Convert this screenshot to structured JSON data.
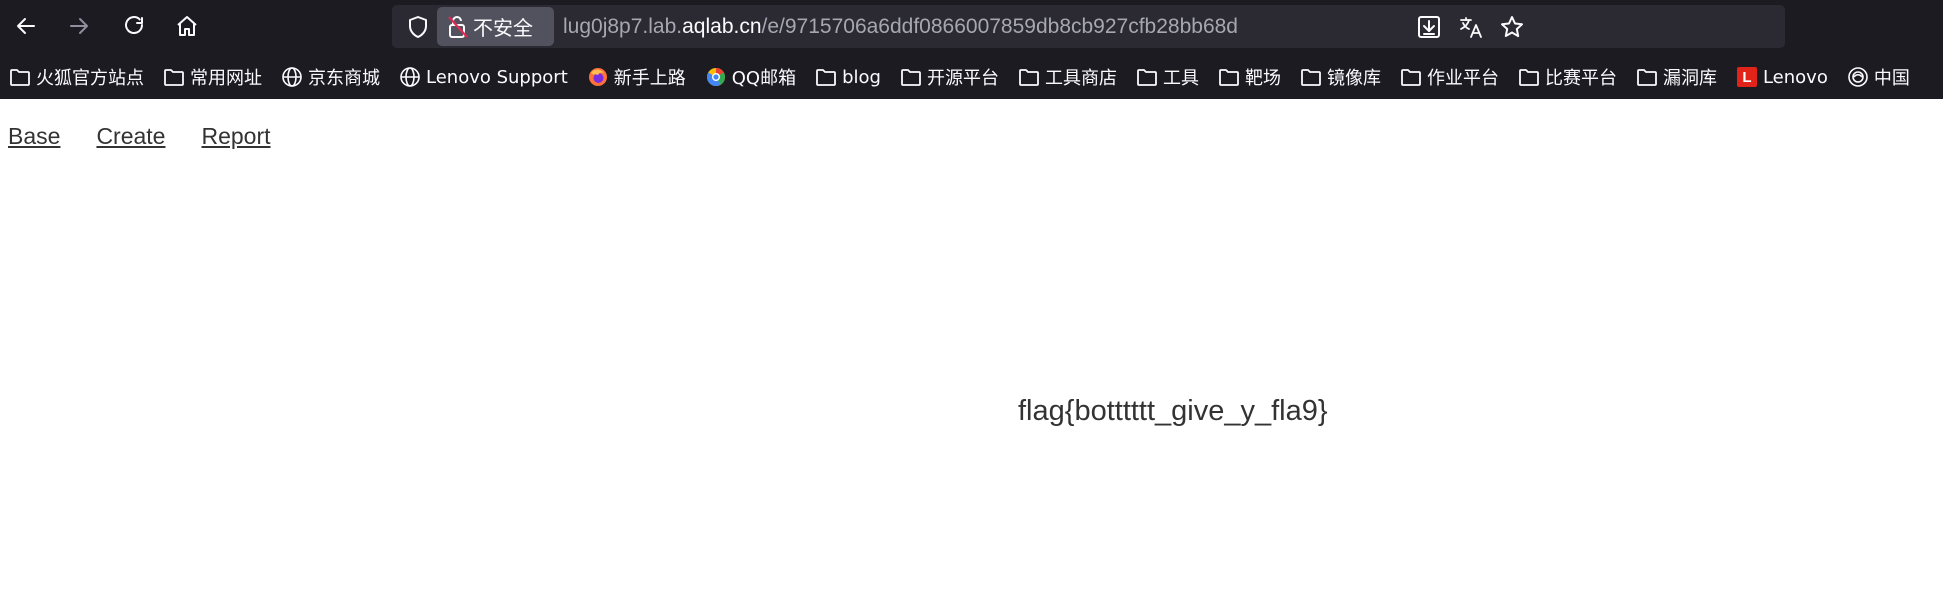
{
  "browser": {
    "security_label": "不安全",
    "url_prefix": "lug0j8p7.lab.",
    "url_host": "aqlab.cn",
    "url_path": "/e/9715706a6ddf0866007859db8cb927cfb28bb68d",
    "nav_icons": [
      "back-arrow-icon",
      "forward-arrow-icon",
      "reload-icon",
      "home-icon"
    ],
    "urlbar_icons": [
      "shield-icon",
      "insecure-lock-icon",
      "download-icon",
      "translate-icon",
      "star-icon"
    ],
    "bookmarks": [
      {
        "label": "火狐官方站点",
        "icon": "folder-icon"
      },
      {
        "label": "常用网址",
        "icon": "folder-icon"
      },
      {
        "label": "京东商城",
        "icon": "globe-icon"
      },
      {
        "label": "Lenovo Support",
        "icon": "globe-icon"
      },
      {
        "label": "新手上路",
        "icon": "firefox-icon"
      },
      {
        "label": "QQ邮箱",
        "icon": "qqmail-icon"
      },
      {
        "label": "blog",
        "icon": "folder-icon"
      },
      {
        "label": "开源平台",
        "icon": "folder-icon"
      },
      {
        "label": "工具商店",
        "icon": "folder-icon"
      },
      {
        "label": "工具",
        "icon": "folder-icon"
      },
      {
        "label": "靶场",
        "icon": "folder-icon"
      },
      {
        "label": "镜像库",
        "icon": "folder-icon"
      },
      {
        "label": "作业平台",
        "icon": "folder-icon"
      },
      {
        "label": "比赛平台",
        "icon": "folder-icon"
      },
      {
        "label": "漏洞库",
        "icon": "folder-icon"
      },
      {
        "label": "Lenovo",
        "icon": "lenovo-icon"
      },
      {
        "label": "中国",
        "icon": "site-icon"
      }
    ],
    "colors": {
      "chrome": "#1c1b22",
      "urlbar": "#2b2a33",
      "insecure_pill": "#52525e"
    }
  },
  "page": {
    "nav": [
      "Base",
      "Create",
      "Report"
    ],
    "flag": "flag{botttttt_give_y_fla9}"
  }
}
